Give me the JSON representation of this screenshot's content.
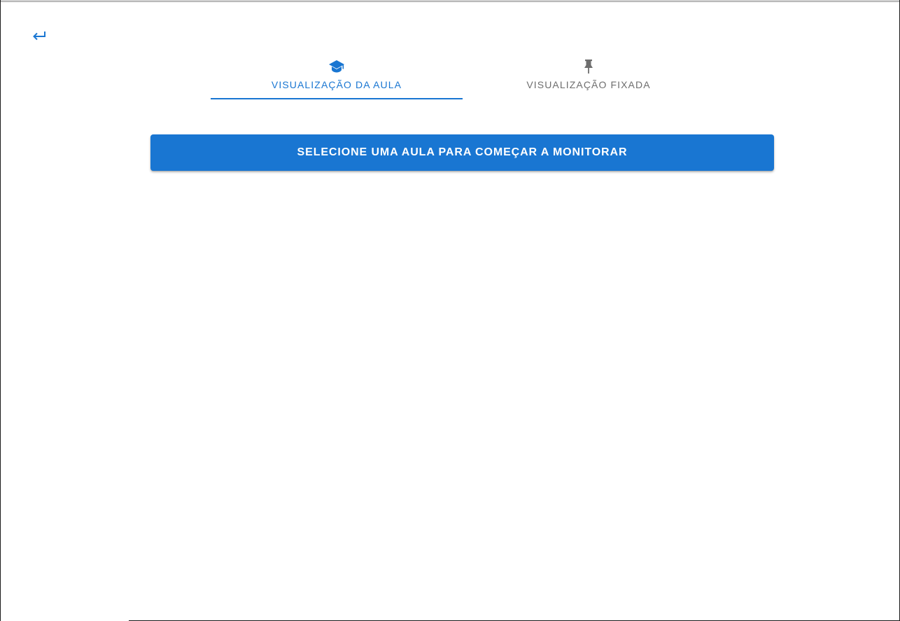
{
  "colors": {
    "primary": "#1976d2",
    "inactive_tab": "#6e6e6e",
    "background": "#ffffff"
  },
  "header": {
    "back_icon": "keyboard-return-icon"
  },
  "tabs": [
    {
      "label": "VISUALIZAÇÃO DA AULA",
      "icon": "graduation-cap-icon",
      "active": true
    },
    {
      "label": "VISUALIZAÇÃO FIXADA",
      "icon": "pin-icon",
      "active": false
    }
  ],
  "main": {
    "select_class_button_label": "SELECIONE UMA AULA PARA COMEÇAR A MONITORAR"
  }
}
